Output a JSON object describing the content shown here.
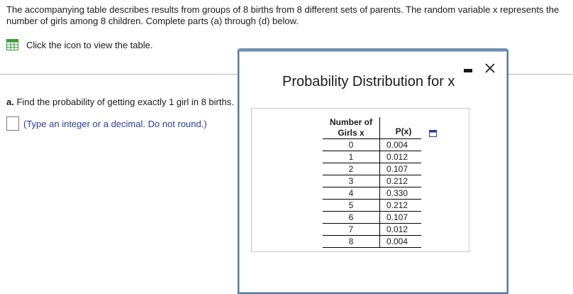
{
  "problem": {
    "intro": "The accompanying table describes results from groups of 8 births from 8 different sets of parents. The random variable x represents the number of girls among 8 children. Complete parts (a) through (d) below.",
    "table_link_label": "Click the icon to view the table.",
    "part_a_label": "a.",
    "part_a_text": " Find the probability of getting exactly 1 girl in 8 births.",
    "answer_hint": "(Type an integer or a decimal. Do not round.)"
  },
  "modal": {
    "title": "Probability Distribution for x",
    "table": {
      "header_x_line1": "Number of",
      "header_x_line2": "Girls x",
      "header_p": "P(x)",
      "rows": [
        {
          "x": "0",
          "p": "0.004"
        },
        {
          "x": "1",
          "p": "0.012"
        },
        {
          "x": "2",
          "p": "0.107"
        },
        {
          "x": "3",
          "p": "0.212"
        },
        {
          "x": "4",
          "p": "0.330"
        },
        {
          "x": "5",
          "p": "0.212"
        },
        {
          "x": "6",
          "p": "0.107"
        },
        {
          "x": "7",
          "p": "0.012"
        },
        {
          "x": "8",
          "p": "0.004"
        }
      ]
    }
  },
  "colors": {
    "accent_blue": "#2a3c9e",
    "grid_icon_green": "#3a9a3a",
    "modal_border": "#58779a"
  }
}
